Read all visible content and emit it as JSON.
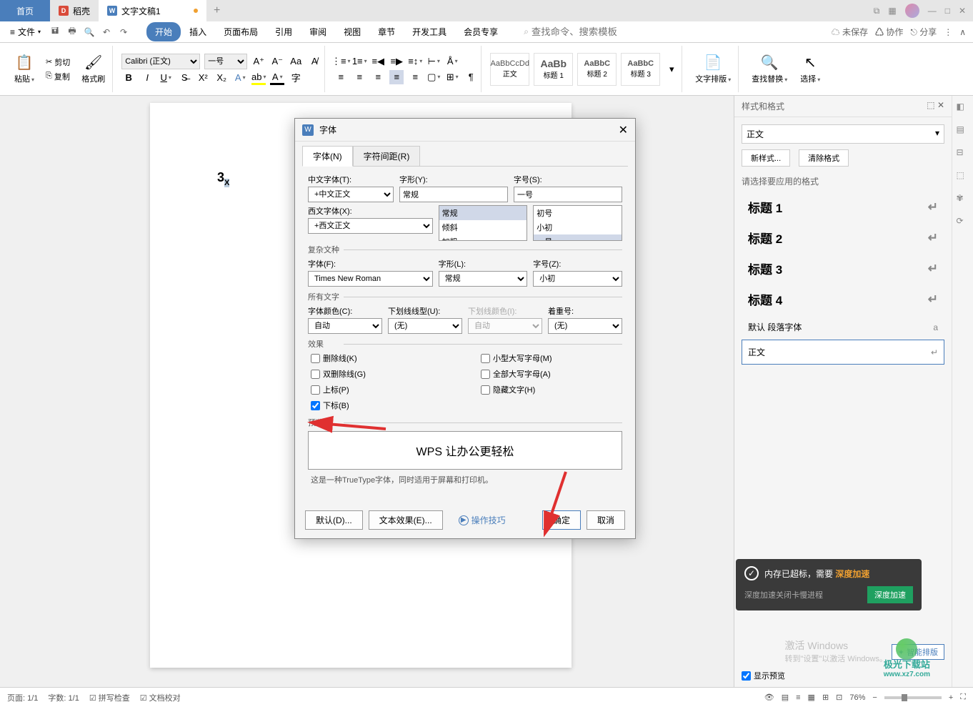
{
  "titlebar": {
    "home": "首页",
    "docer": "稻壳",
    "docTab": "文字文稿1"
  },
  "menubar": {
    "file": "文件",
    "tabs": {
      "start": "开始",
      "insert": "插入",
      "pageLayout": "页面布局",
      "reference": "引用",
      "review": "审阅",
      "view": "视图",
      "chapter": "章节",
      "devtools": "开发工具",
      "member": "会员专享"
    },
    "searchPlaceholder": "查找命令、搜索模板",
    "unsaved": "未保存",
    "collab": "协作",
    "share": "分享"
  },
  "ribbon": {
    "paste": "粘贴",
    "cut": "剪切",
    "copy": "复制",
    "formatPainter": "格式刷",
    "fontName": "Calibri (正文)",
    "fontSize": "一号",
    "styleNormal": "正文",
    "styleH1": "标题 1",
    "styleH2": "标题 2",
    "styleH3": "标题 3",
    "stylePreview": "AaBbCcDd",
    "stylePreviewB": "AaBb",
    "stylePreviewC": "AaBbC",
    "stylePreviewD": "AaBbC",
    "textLayout": "文字排版",
    "findReplace": "查找替换",
    "select": "选择"
  },
  "document": {
    "text": "3",
    "sub": "X"
  },
  "dialog": {
    "title": "字体",
    "tab1": "字体(N)",
    "tab2": "字符间距(R)",
    "cnFontLabel": "中文字体(T):",
    "cnFont": "+中文正文",
    "enFontLabel": "西文字体(X):",
    "enFont": "+西文正文",
    "styleLabel": "字形(Y):",
    "styleValue": "常规",
    "styleOpts": {
      "o1": "常规",
      "o2": "倾斜",
      "o3": "加粗"
    },
    "sizeLabel": "字号(S):",
    "sizeValue": "一号",
    "sizeOpts": {
      "o1": "初号",
      "o2": "小初",
      "o3": "一号"
    },
    "complexScript": "复杂文种",
    "fontFLabel": "字体(F):",
    "fontF": "Times New Roman",
    "styleLLabel": "字形(L):",
    "styleL": "常规",
    "sizeZLabel": "字号(Z):",
    "sizeZ": "小初",
    "allText": "所有文字",
    "fontColorLabel": "字体颜色(C):",
    "fontColor": "自动",
    "underlineLabel": "下划线线型(U):",
    "underline": "(无)",
    "underlineColorLabel": "下划线颜色(I):",
    "underlineColor": "自动",
    "emphasisLabel": "着重号:",
    "emphasis": "(无)",
    "effects": "效果",
    "chk": {
      "strike": "删除线(K)",
      "dblStrike": "双删除线(G)",
      "superscript": "上标(P)",
      "subscript": "下标(B)",
      "smallCaps": "小型大写字母(M)",
      "allCaps": "全部大写字母(A)",
      "hidden": "隐藏文字(H)"
    },
    "preview": "预览",
    "previewText": "WPS 让办公更轻松",
    "previewNote": "这是一种TrueType字体，同时适用于屏幕和打印机。",
    "btnDefault": "默认(D)...",
    "btnTextEffect": "文本效果(E)...",
    "btnTips": "操作技巧",
    "btnOk": "确定",
    "btnCancel": "取消"
  },
  "panel": {
    "title": "样式和格式",
    "current": "正文",
    "newStyle": "新样式...",
    "clearFormat": "清除格式",
    "pickLabel": "请选择要应用的格式",
    "items": {
      "h1": "标题 1",
      "h2": "标题 2",
      "h3": "标题 3",
      "h4": "标题 4",
      "defaultPara": "默认 段落字体",
      "normal": "正文"
    },
    "showPreview": "显示预览",
    "smartLayout": "智能排版"
  },
  "notif": {
    "line1a": "内存已超标，需要 ",
    "line1b": "深度加速",
    "line2": "深度加速关闭卡慢进程",
    "btn": "深度加速"
  },
  "activate": {
    "title": "激活 Windows",
    "sub": "转到\"设置\"以激活 Windows。"
  },
  "status": {
    "page": "页面: 1/1",
    "words": "字数: 1/1",
    "spellcheck": "拼写检查",
    "proofread": "文档校对",
    "zoom": "76%"
  },
  "siteLogo": {
    "name": "极光下载站",
    "url": "www.xz7.com"
  }
}
